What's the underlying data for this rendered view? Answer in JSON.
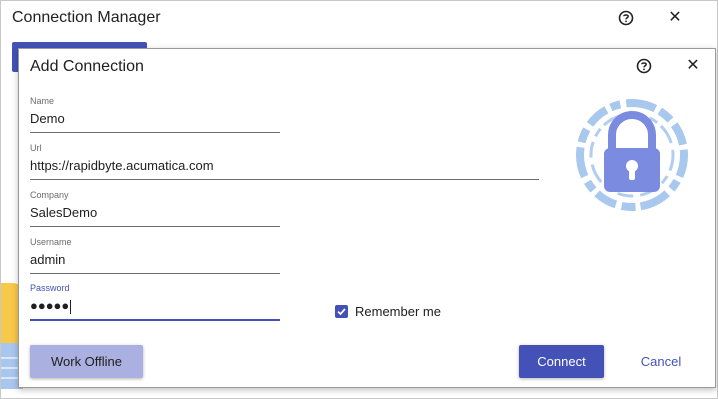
{
  "background_window": {
    "title": "Connection Manager",
    "help_icon": "help-circle-icon",
    "close_icon": "close-icon"
  },
  "dialog": {
    "title": "Add Connection",
    "help_icon": "help-circle-icon",
    "close_icon": "close-icon",
    "close_glyph": "✕",
    "lock_icon": "lock-icon"
  },
  "fields": {
    "name": {
      "label": "Name",
      "value": "Demo"
    },
    "url": {
      "label": "Url",
      "value": "https://rapidbyte.acumatica.com"
    },
    "company": {
      "label": "Company",
      "value": "SalesDemo"
    },
    "username": {
      "label": "Username",
      "value": "admin"
    },
    "password": {
      "label": "Password",
      "value": "●●●●●"
    }
  },
  "remember": {
    "label": "Remember me",
    "checked": true
  },
  "buttons": {
    "work_offline": "Work Offline",
    "connect": "Connect",
    "cancel": "Cancel"
  },
  "colors": {
    "accent": "#4452b8",
    "offline_button": "#aab0e0",
    "lock_art": "#7b8ce0",
    "lock_ring": "#a9c8ee"
  }
}
